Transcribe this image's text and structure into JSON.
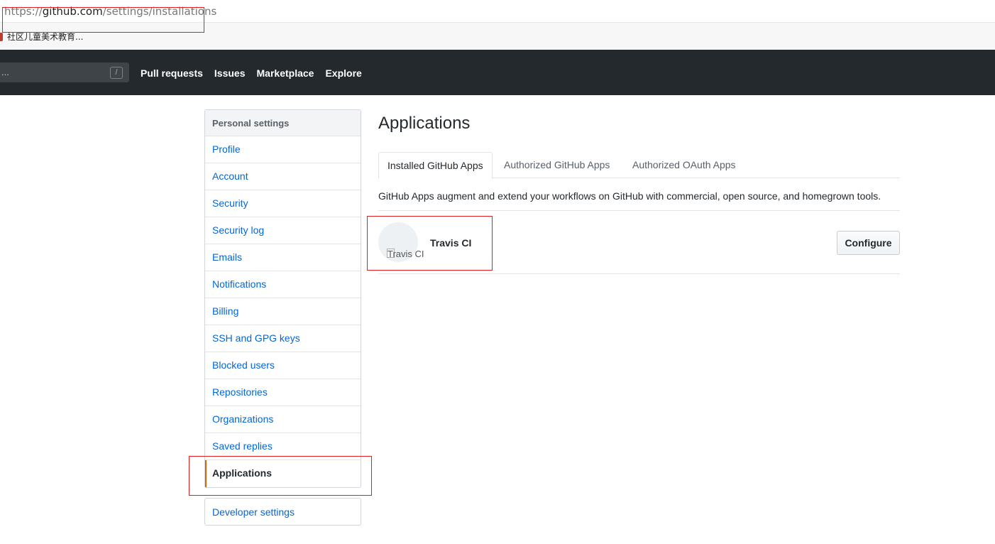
{
  "browser": {
    "url_scheme": "https://",
    "url_host": "github.com",
    "url_path": "/settings/installations",
    "bookmark": "社区儿童美术教育..."
  },
  "header": {
    "search_placeholder": "...",
    "search_shortcut": "/",
    "nav": [
      "Pull requests",
      "Issues",
      "Marketplace",
      "Explore"
    ]
  },
  "sidebar": {
    "heading": "Personal settings",
    "items": [
      {
        "label": "Profile"
      },
      {
        "label": "Account"
      },
      {
        "label": "Security"
      },
      {
        "label": "Security log"
      },
      {
        "label": "Emails"
      },
      {
        "label": "Notifications"
      },
      {
        "label": "Billing"
      },
      {
        "label": "SSH and GPG keys"
      },
      {
        "label": "Blocked users"
      },
      {
        "label": "Repositories"
      },
      {
        "label": "Organizations"
      },
      {
        "label": "Saved replies"
      },
      {
        "label": "Applications"
      }
    ],
    "active_item": "Applications",
    "developer_settings": "Developer settings"
  },
  "main": {
    "title": "Applications",
    "tabs": [
      "Installed GitHub Apps",
      "Authorized GitHub Apps",
      "Authorized OAuth Apps"
    ],
    "selected_tab": "Installed GitHub Apps",
    "description": "GitHub Apps augment and extend your workflows on GitHub with commercial, open source, and homegrown tools.",
    "apps": [
      {
        "avatar_alt": "Travis CI",
        "name": "Travis CI",
        "action": "Configure"
      }
    ]
  },
  "colors": {
    "header_bg": "#24292e",
    "link": "#0366d6",
    "active_marker": "#e36209",
    "annotation": "#e02020"
  }
}
